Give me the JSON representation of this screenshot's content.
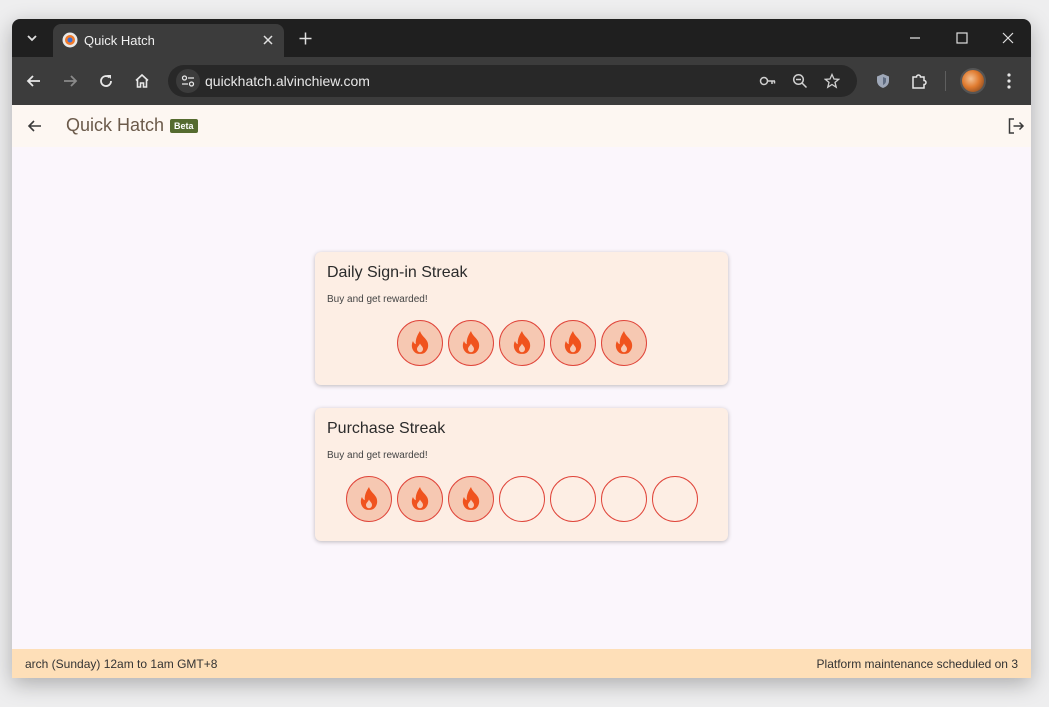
{
  "browser": {
    "tab_title": "Quick Hatch",
    "url": "quickhatch.alvinchiew.com"
  },
  "app": {
    "title": "Quick Hatch",
    "badge": "Beta"
  },
  "cards": [
    {
      "title": "Daily Sign-in Streak",
      "subtitle": "Buy and get rewarded!",
      "total": 5,
      "completed": 5
    },
    {
      "title": "Purchase Streak",
      "subtitle": "Buy and get rewarded!",
      "total": 7,
      "completed": 3
    }
  ],
  "footer": {
    "left": "arch (Sunday) 12am to 1am GMT+8",
    "right": "Platform maintenance scheduled on 3"
  },
  "colors": {
    "accent": "#e0453a",
    "flame": "#f0531e",
    "filled_circle": "#f6c8b2",
    "card_bg": "#fdeee4",
    "footer_bg": "#fedfb8",
    "badge_bg": "#556b2f"
  },
  "icons": {
    "streak": "fire-icon",
    "back": "arrow-back-icon",
    "logout": "logout-icon"
  }
}
